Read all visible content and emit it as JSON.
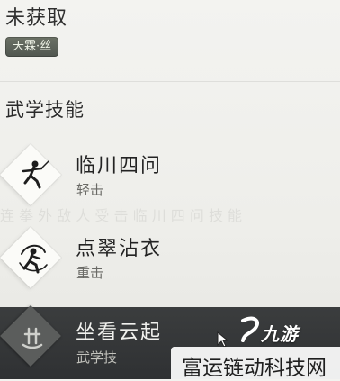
{
  "header": {
    "status": "未获取",
    "badge": "天霖·丝"
  },
  "section": {
    "title": "武学技能"
  },
  "background_text": "连 拳 外 敌 人 受 击 临 川 四 问 技 能",
  "skills": [
    {
      "name": "临川四问",
      "type": "轻击",
      "icon": "sword-figure-icon"
    },
    {
      "name": "点翠沾衣",
      "type": "重击",
      "icon": "spin-figure-icon"
    },
    {
      "name": "坐看云起",
      "type": "武学技",
      "icon": "martial-sigil-icon"
    }
  ],
  "overlay": {
    "logo_text": "九游",
    "watermark": "富运链动科技网"
  },
  "colors": {
    "badge": "#5d6359",
    "selected_row": "#353738",
    "logo": "#ffffff"
  }
}
